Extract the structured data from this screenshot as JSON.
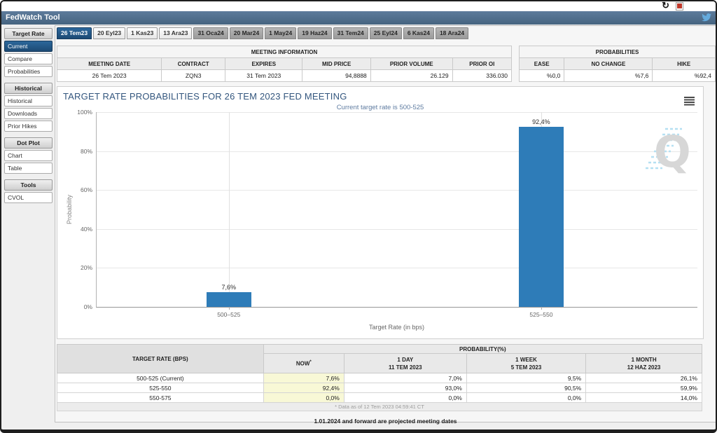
{
  "topbar": {
    "title": "FedWatch Tool",
    "refresh_glyph": "↻"
  },
  "sidebar": {
    "groups": [
      {
        "header": "Target Rate",
        "items": [
          {
            "label": "Current",
            "selected": true
          },
          {
            "label": "Compare",
            "selected": false
          },
          {
            "label": "Probabilities",
            "selected": false
          }
        ]
      },
      {
        "header": "Historical",
        "items": [
          {
            "label": "Historical",
            "selected": false
          },
          {
            "label": "Downloads",
            "selected": false
          },
          {
            "label": "Prior Hikes",
            "selected": false
          }
        ]
      },
      {
        "header": "Dot Plot",
        "items": [
          {
            "label": "Chart",
            "selected": false
          },
          {
            "label": "Table",
            "selected": false
          }
        ]
      },
      {
        "header": "Tools",
        "items": [
          {
            "label": "CVOL",
            "selected": false
          }
        ]
      }
    ]
  },
  "tabs": [
    {
      "label": "26 Tem23",
      "state": "selected"
    },
    {
      "label": "20 Eyl23",
      "state": "near"
    },
    {
      "label": "1 Kas23",
      "state": "near"
    },
    {
      "label": "13 Ara23",
      "state": "near"
    },
    {
      "label": "31 Oca24",
      "state": "far"
    },
    {
      "label": "20 Mar24",
      "state": "far"
    },
    {
      "label": "1 May24",
      "state": "far"
    },
    {
      "label": "19 Haz24",
      "state": "far"
    },
    {
      "label": "31 Tem24",
      "state": "far"
    },
    {
      "label": "25 Eyl24",
      "state": "far"
    },
    {
      "label": "6 Kas24",
      "state": "far"
    },
    {
      "label": "18 Ara24",
      "state": "far"
    }
  ],
  "meeting_info": {
    "title": "MEETING INFORMATION",
    "columns": [
      "MEETING DATE",
      "CONTRACT",
      "EXPIRES",
      "MID PRICE",
      "PRIOR VOLUME",
      "PRIOR OI"
    ],
    "values": [
      "26 Tem 2023",
      "ZQN3",
      "31 Tem 2023",
      "94,8888",
      "26.129",
      "336.030"
    ]
  },
  "probabilities_summary": {
    "title": "PROBABILITIES",
    "columns": [
      "EASE",
      "NO CHANGE",
      "HIKE"
    ],
    "values": [
      "%0,0",
      "%7,6",
      "%92,4"
    ]
  },
  "chart_data": {
    "type": "bar",
    "title": "TARGET RATE PROBABILITIES FOR 26 TEM 2023 FED MEETING",
    "subtitle": "Current target rate is 500-525",
    "categories": [
      "500–525",
      "525–550"
    ],
    "values": [
      7.6,
      92.4
    ],
    "bar_labels": [
      "7,6%",
      "92,4%"
    ],
    "xlabel": "Target Rate (in bps)",
    "ylabel": "Probability",
    "ylim": [
      0,
      100
    ],
    "yticks": [
      "100%",
      "80%",
      "60%",
      "40%",
      "20%",
      "0%"
    ],
    "bar_color": "#2e7cb8",
    "grid": true,
    "legend": false,
    "watermark_glyph": "Q"
  },
  "probability_table": {
    "rate_header": "TARGET RATE (BPS)",
    "group_header": "PROBABILITY(%)",
    "columns": [
      {
        "l1": "NOW",
        "sup": "*",
        "l2": ""
      },
      {
        "l1": "1 DAY",
        "l2": "11 TEM 2023"
      },
      {
        "l1": "1 WEEK",
        "l2": "5 TEM 2023"
      },
      {
        "l1": "1 MONTH",
        "l2": "12 HAZ 2023"
      }
    ],
    "rows": [
      {
        "rate": "500-525 (Current)",
        "now": "7,6%",
        "day": "7,0%",
        "week": "9,5%",
        "month": "26,1%"
      },
      {
        "rate": "525-550",
        "now": "92,4%",
        "day": "93,0%",
        "week": "90,5%",
        "month": "59,9%"
      },
      {
        "rate": "550-575",
        "now": "0,0%",
        "day": "0,0%",
        "week": "0,0%",
        "month": "14,0%"
      }
    ],
    "footnote": "* Data as of 12 Tem 2023 04:59:41 CT"
  },
  "footer_note": "1.01.2024 and forward are projected meeting dates",
  "colors": {
    "accent_navy": "#1d4e7a",
    "topbar_blue": "#4e6d8f",
    "bar_blue": "#2e7cb8",
    "highlight_yellow": "#f8f8d6",
    "title_blue": "#33567e",
    "twitter_blue": "#64aadc"
  }
}
